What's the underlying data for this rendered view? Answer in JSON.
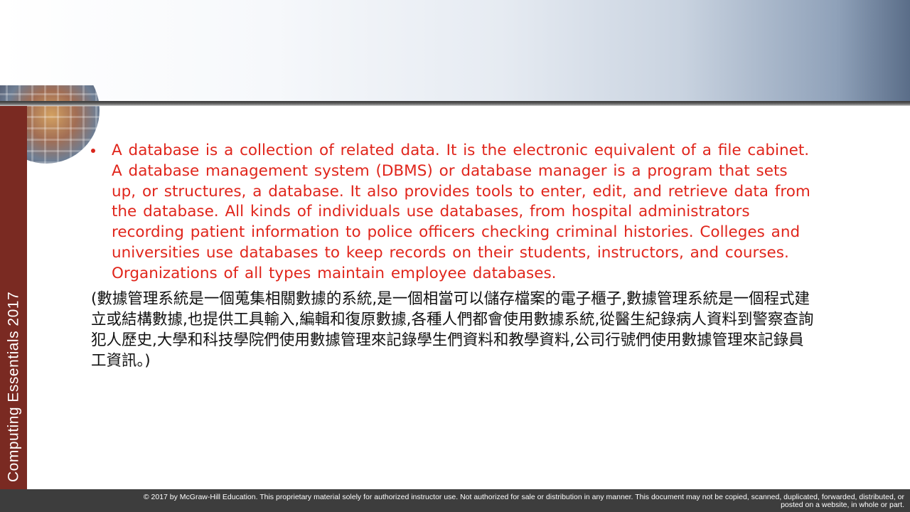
{
  "slide": {
    "sidebar_title": "Computing Essentials 2017",
    "bullet_text": "A database is a collection of related data. It is the electronic equivalent of a file cabinet. A database management system (DBMS) or database manager is a program that sets up, or structures, a database. It also provides tools to enter, edit, and retrieve data from the database. All kinds of individuals use databases, from hospital administrators recording patient information to police officers checking criminal histories. Colleges and universities use databases to keep records on their students, instructors, and courses. Organizations of all types maintain employee databases.",
    "chinese_text": "(數據管理系統是一個蒐集相關數據的系統,是一個相當可以儲存檔案的電子櫃子,數據管理系統是一個程式建立或結構數據,也提供工具輸入,編輯和復原數據,各種人們都會使用數據系統,從醫生紀錄病人資料到警察查詢犯人歷史,大學和科技學院們使用數據管理來記錄學生們資料和教學資料,公司行號們使用數據管理來記錄員工資訊。)",
    "footer_line1": "© 2017 by McGraw-Hill Education. This proprietary material solely for authorized instructor use. Not authorized for sale or distribution in any manner. This document may not be copied, scanned, duplicated, forwarded, distributed, or",
    "footer_line2": "posted on a website, in whole or part."
  },
  "colors": {
    "sidebar": "#7a2a22",
    "bullet_text": "#e0251b",
    "footer_bg": "#3d3d3d"
  }
}
